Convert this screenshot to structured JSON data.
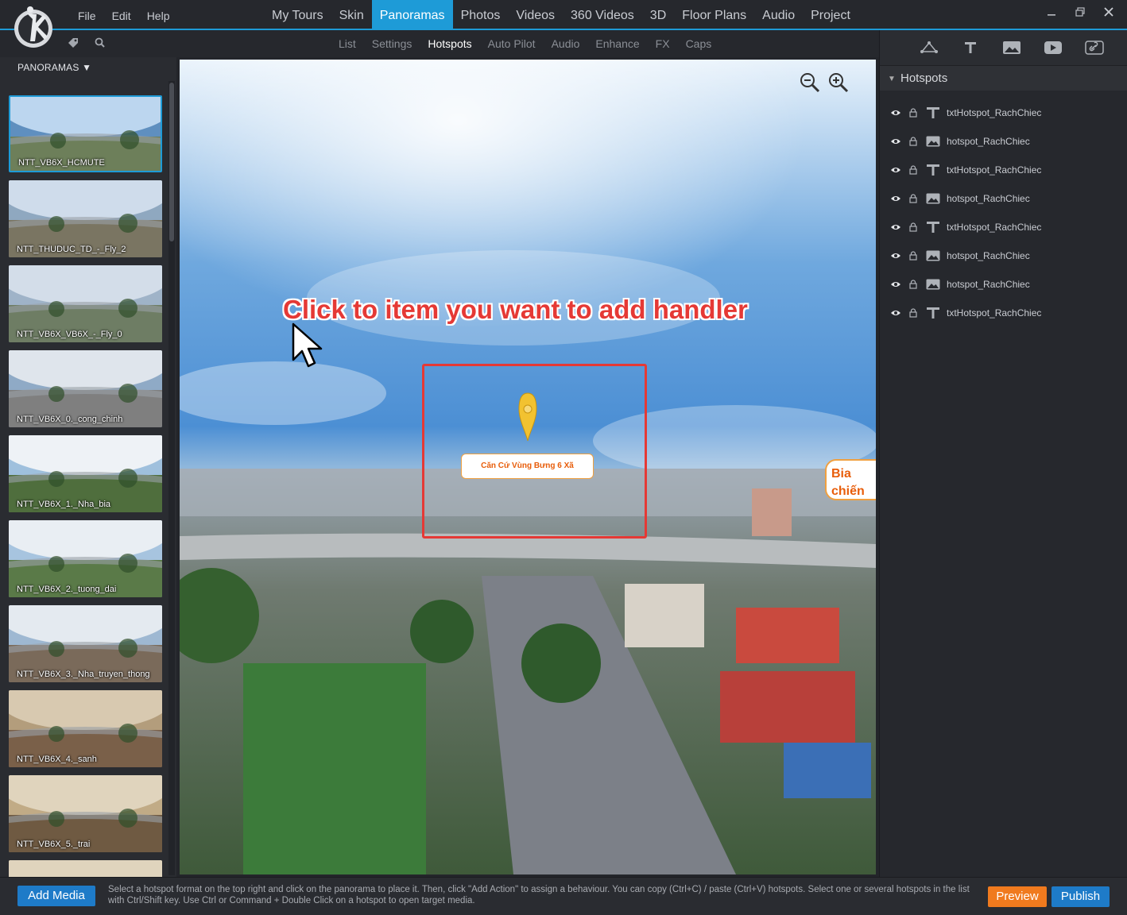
{
  "menu": [
    "File",
    "Edit",
    "Help"
  ],
  "main_tabs": [
    {
      "label": "My Tours",
      "active": false
    },
    {
      "label": "Skin",
      "active": false
    },
    {
      "label": "Panoramas",
      "active": true
    },
    {
      "label": "Photos",
      "active": false
    },
    {
      "label": "Videos",
      "active": false
    },
    {
      "label": "360 Videos",
      "active": false
    },
    {
      "label": "3D",
      "active": false
    },
    {
      "label": "Floor Plans",
      "active": false
    },
    {
      "label": "Audio",
      "active": false
    },
    {
      "label": "Project",
      "active": false
    }
  ],
  "window_controls": [
    "minimize-icon",
    "restore-icon",
    "close-icon"
  ],
  "sub_tabs": [
    {
      "label": "List",
      "active": false
    },
    {
      "label": "Settings",
      "active": false
    },
    {
      "label": "Hotspots",
      "active": true
    },
    {
      "label": "Auto Pilot",
      "active": false
    },
    {
      "label": "Audio",
      "active": false
    },
    {
      "label": "Enhance",
      "active": false
    },
    {
      "label": "FX",
      "active": false
    },
    {
      "label": "Caps",
      "active": false
    }
  ],
  "left_panel": {
    "header": "PANORAMAS ▼",
    "items": [
      {
        "label": "NTT_VB6X_HCMUTE",
        "selected": true
      },
      {
        "label": "NTT_THUDUC_TD_-_Fly_2",
        "selected": false
      },
      {
        "label": "NTT_VB6X_VB6X_-_Fly_0",
        "selected": false
      },
      {
        "label": "NTT_VB6X_0._cong_chinh",
        "selected": false
      },
      {
        "label": "NTT_VB6X_1._Nha_bia",
        "selected": false
      },
      {
        "label": "NTT_VB6X_2._tuong_dai",
        "selected": false
      },
      {
        "label": "NTT_VB6X_3._Nha_truyen_thong",
        "selected": false
      },
      {
        "label": "NTT_VB6X_4._sanh",
        "selected": false
      },
      {
        "label": "NTT_VB6X_5._trai",
        "selected": false
      },
      {
        "label": "",
        "selected": false
      }
    ]
  },
  "viewer": {
    "instruction": "Click to item you want to add handler",
    "hotspot_label": "Căn Cứ Vùng Bưng 6 Xã",
    "side_hotspot_text": "Bia\nchiến",
    "zoom_icons": [
      "zoom-out-icon",
      "zoom-in-icon"
    ]
  },
  "right_panel": {
    "tools": [
      "polygon-hotspot-icon",
      "text-hotspot-icon",
      "image-hotspot-icon",
      "video-hotspot-icon",
      "link-hotspot-icon"
    ],
    "section_title": "Hotspots",
    "hotspots": [
      {
        "name": "txtHotspot_RachChiec",
        "type": "text"
      },
      {
        "name": "hotspot_RachChiec",
        "type": "image"
      },
      {
        "name": "txtHotspot_RachChiec",
        "type": "text"
      },
      {
        "name": "hotspot_RachChiec",
        "type": "image"
      },
      {
        "name": "txtHotspot_RachChiec",
        "type": "text"
      },
      {
        "name": "hotspot_RachChiec",
        "type": "image"
      },
      {
        "name": "hotspot_RachChiec",
        "type": "image"
      },
      {
        "name": "txtHotspot_RachChiec",
        "type": "text"
      }
    ]
  },
  "bottom": {
    "add_media": "Add Media",
    "help_text": "Select a hotspot format on the top right and click on the panorama to place it. Then, click \"Add Action\" to assign a behaviour. You can copy (Ctrl+C) / paste (Ctrl+V) hotspots. Select one or several hotspots in the list with Ctrl/Shift key. Use Ctrl or Command + Double Click on a hotspot to open target media.",
    "preview": "Preview",
    "publish": "Publish"
  },
  "colors": {
    "accent": "#1e9bd7",
    "preview": "#f07a1e",
    "publish": "#1e7bc8",
    "highlight": "#e53935"
  }
}
